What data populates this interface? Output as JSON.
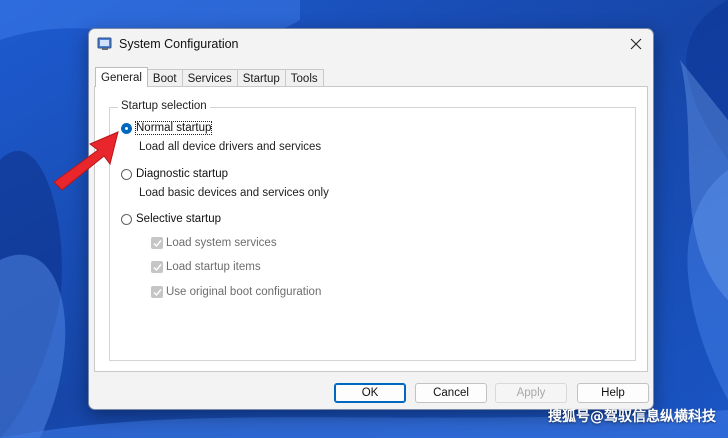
{
  "window": {
    "title": "System Configuration",
    "app_icon": "msconfig-icon",
    "close_icon": "close-icon"
  },
  "tabs": [
    {
      "label": "General",
      "active": true
    },
    {
      "label": "Boot",
      "active": false
    },
    {
      "label": "Services",
      "active": false
    },
    {
      "label": "Startup",
      "active": false
    },
    {
      "label": "Tools",
      "active": false
    }
  ],
  "startup_selection": {
    "group_label": "Startup selection",
    "normal": {
      "label": "Normal startup",
      "selected": true,
      "description": "Load all device drivers and services"
    },
    "diagnostic": {
      "label": "Diagnostic startup",
      "selected": false,
      "description": "Load basic devices and services only"
    },
    "selective": {
      "label": "Selective startup",
      "selected": false,
      "options": [
        {
          "label": "Load system services",
          "checked": true,
          "enabled": false
        },
        {
          "label": "Load startup items",
          "checked": true,
          "enabled": false
        },
        {
          "label": "Use original boot configuration",
          "checked": true,
          "enabled": false
        }
      ]
    }
  },
  "buttons": {
    "ok": "OK",
    "cancel": "Cancel",
    "apply": "Apply",
    "help": "Help"
  },
  "watermark": "搜狐号@驾驭信息纵横科技",
  "colors": {
    "accent": "#0067c0",
    "arrow": "#e8262b",
    "wallpaper": "#1b4fb8"
  }
}
